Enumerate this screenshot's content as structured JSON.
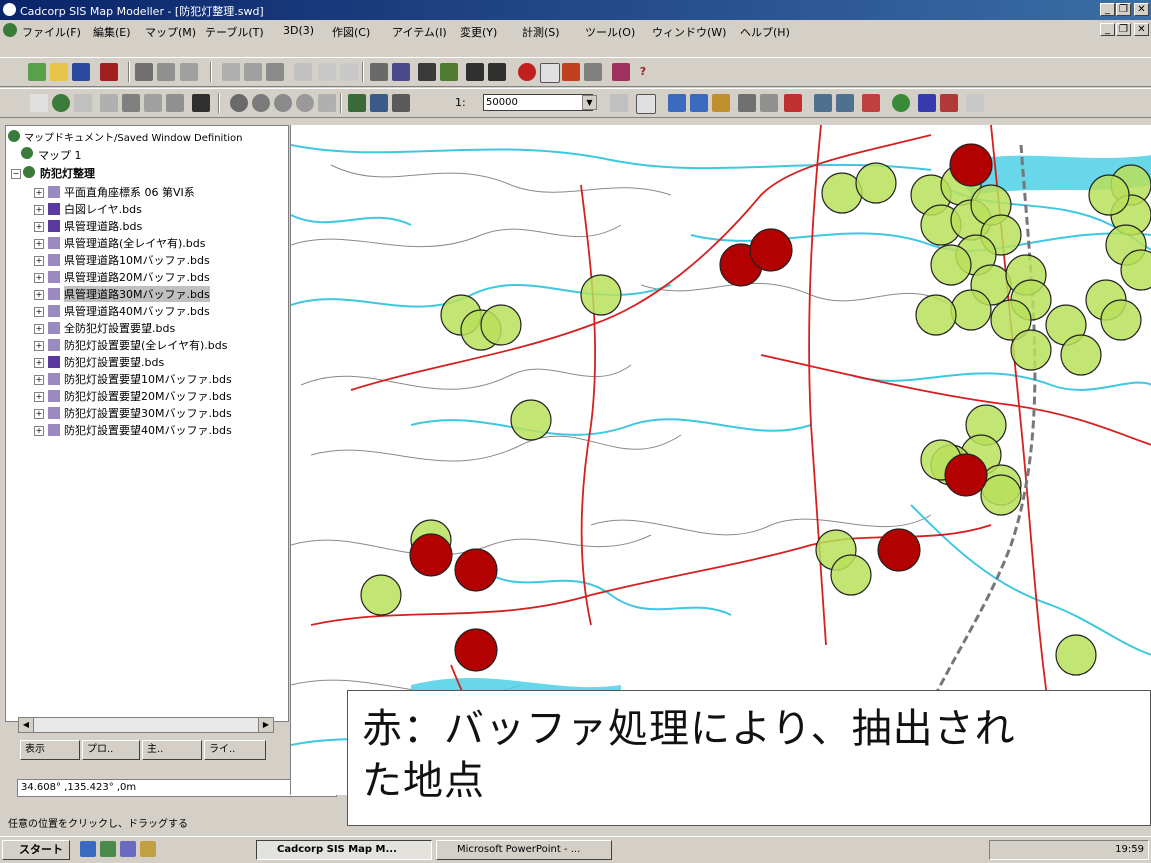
{
  "window": {
    "title": "Cadcorp SIS Map Modeller - [防犯灯整理.swd]",
    "min": "_",
    "restore": "❐",
    "close": "✕",
    "mdi_min": "_",
    "mdi_restore": "❐",
    "mdi_close": "✕"
  },
  "menu": [
    "ファイル(F)",
    "編集(E)",
    "マップ(M)",
    "テーブル(T)",
    "3D(3)",
    "作図(C)",
    "アイテム(I)",
    "変更(Y)",
    "計測(S)",
    "ツール(O)",
    "ウィンドウ(W)",
    "ヘルプ(H)"
  ],
  "toolbar2": {
    "scale_prefix": "1:",
    "scale_value": "50000"
  },
  "tree": {
    "root": "マップドキュメント/Saved Window Definition",
    "map1": "マップ 1",
    "group": "防犯灯整理",
    "layers": [
      "平面直角座標系 06 第VI系",
      "白図レイヤ.bds",
      "県管理道路.bds",
      "県管理道路(全レイヤ有).bds",
      "県管理道路10Mバッファ.bds",
      "県管理道路20Mバッファ.bds",
      "県管理道路30Mバッファ.bds",
      "県管理道路40Mバッファ.bds",
      "全防犯灯設置要望.bds",
      "防犯灯設置要望(全レイヤ有).bds",
      "防犯灯設置要望.bds",
      "防犯灯設置要望10Mバッファ.bds",
      "防犯灯設置要望20Mバッファ.bds",
      "防犯灯設置要望30Mバッファ.bds",
      "防犯灯設置要望40Mバッファ.bds"
    ],
    "selected_index": 6
  },
  "panel_tabs": [
    "表示",
    "プロ..",
    "主..",
    "ライ.."
  ],
  "coord_readout": "34.608° ,135.423° ,0m",
  "status_text": "任意の位置をクリックし、ドラッグする",
  "caption_line1": "赤：バッファ処理により、抽出され",
  "caption_line2": "た地点",
  "taskbar": {
    "start": "スタート",
    "tasks": [
      "Cadcorp SIS Map M...",
      "Microsoft PowerPoint - ..."
    ],
    "clock": "19:59"
  },
  "colors": {
    "red_point": "#b30000",
    "green_buffer": "#b8e05a",
    "water": "#3ec8e0",
    "road": "#d42020",
    "contour": "#7a7a7a"
  },
  "map_points": {
    "red": 9,
    "green": "approximate count"
  }
}
